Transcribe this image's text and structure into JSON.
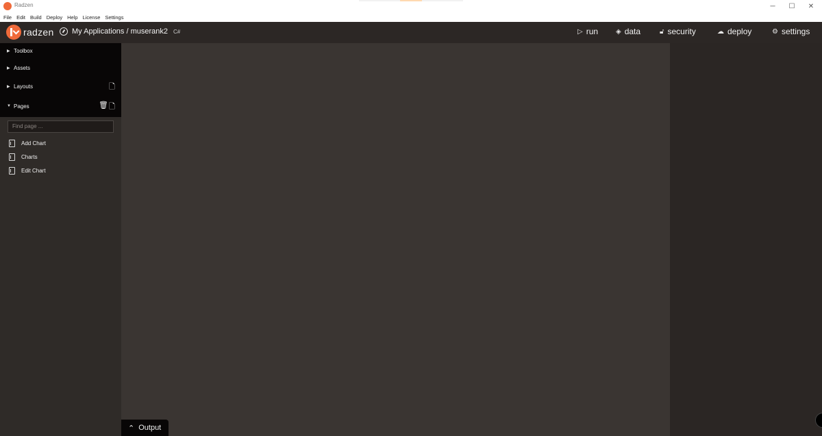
{
  "window": {
    "title": "Radzen",
    "controls": [
      "─",
      "☐",
      "✕"
    ]
  },
  "menubar": {
    "items": [
      "File",
      "Edit",
      "Build",
      "Deploy",
      "Help",
      "License",
      "Settings"
    ]
  },
  "topbar": {
    "brand": "radzen",
    "breadcrumb": "My Applications / muserank2",
    "tech_badge": "C#",
    "nav": [
      {
        "label": "run",
        "icon": "play-icon"
      },
      {
        "label": "data",
        "icon": "layers-icon"
      },
      {
        "label": "security",
        "icon": "lock-icon"
      },
      {
        "label": "deploy",
        "icon": "cloud-upload-icon"
      },
      {
        "label": "settings",
        "icon": "gear-icon"
      }
    ]
  },
  "sidebar": {
    "sections": [
      {
        "label": "Toolbox",
        "expanded": false
      },
      {
        "label": "Assets",
        "expanded": false
      },
      {
        "label": "Layouts",
        "expanded": false
      },
      {
        "label": "Pages",
        "expanded": true
      }
    ],
    "find_placeholder": "Find page ...",
    "pages": [
      "Add Chart",
      "Charts",
      "Edit Chart"
    ]
  },
  "output": {
    "label": "Output"
  },
  "colors": {
    "accent": "#f06a3a",
    "topbar": "#2c2725",
    "canvas": "#3a3532",
    "sidebar": "#2f2b28",
    "section_header": "#080606"
  }
}
